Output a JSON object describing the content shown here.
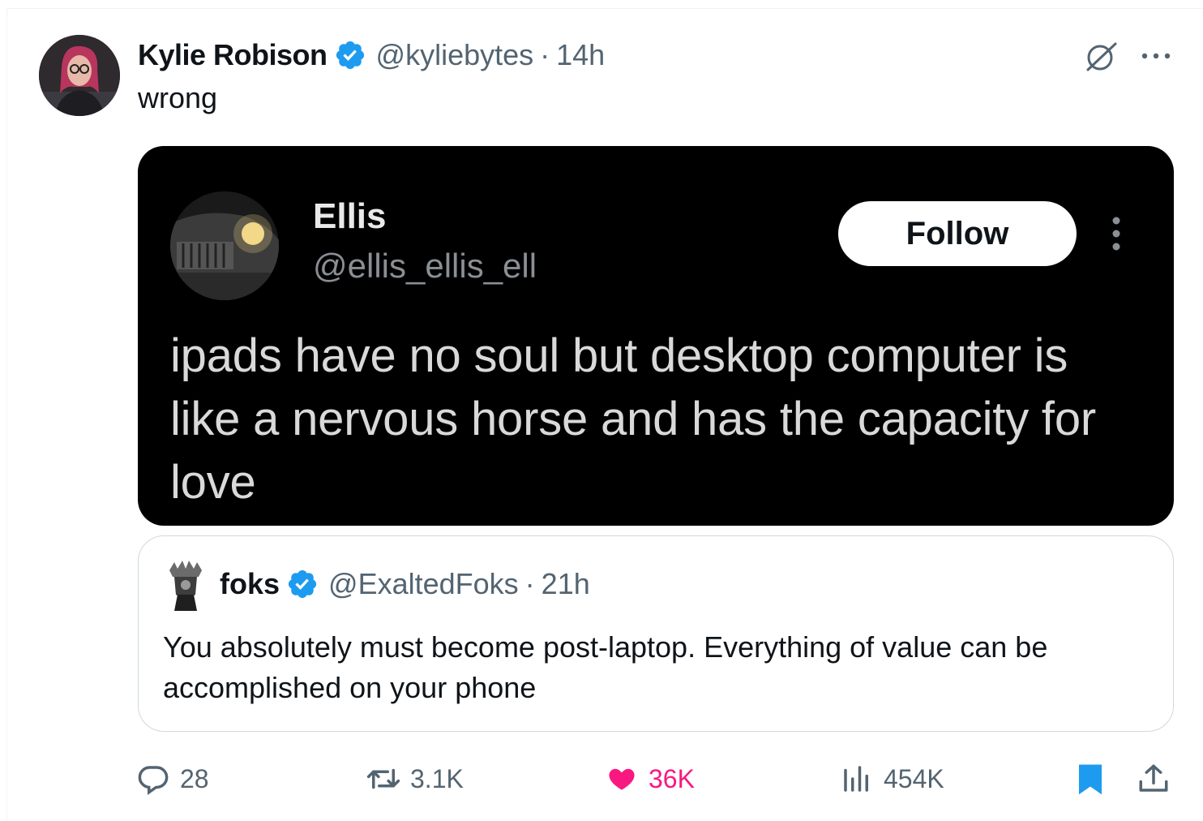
{
  "tweet": {
    "author": {
      "display_name": "Kylie Robison",
      "handle": "@kyliebytes",
      "time": "14h",
      "separator": "·",
      "verified": true
    },
    "text": "wrong",
    "icons": [
      "grok-icon",
      "more-icon"
    ],
    "media": {
      "author_name": "Ellis",
      "author_handle": "@ellis_ellis_ell",
      "follow_label": "Follow",
      "text": "ipads have no soul but desktop computer is like a nervous horse and has the capacity for love"
    },
    "quote": {
      "display_name": "foks",
      "handle": "@ExaltedFoks",
      "separator": "·",
      "time": "21h",
      "verified": true,
      "text": "You absolutely must become post-laptop. Everything of value can be accomplished on your phone"
    },
    "actions": {
      "replies": "28",
      "reposts": "3.1K",
      "likes": "36K",
      "views": "454K"
    }
  },
  "colors": {
    "text": "#0f1419",
    "secondary": "#536471",
    "verified": "#1d9bf0",
    "like": "#f91880",
    "bookmark": "#1d9bf0",
    "border": "#cfd9de"
  }
}
